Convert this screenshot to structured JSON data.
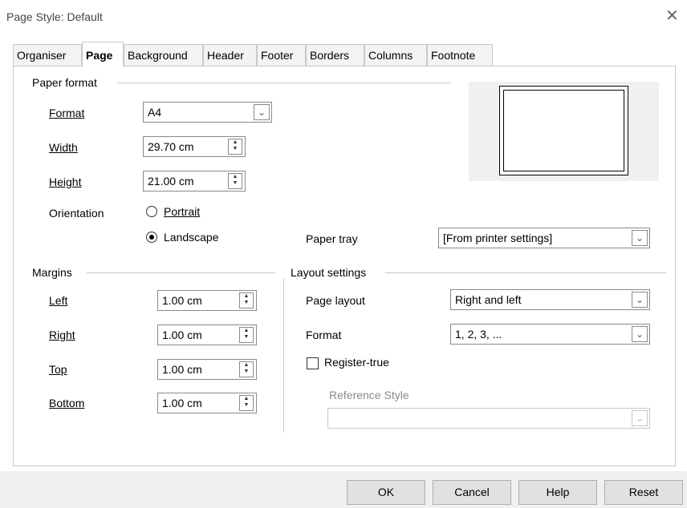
{
  "window": {
    "title": "Page Style: Default",
    "close_glyph": "✕"
  },
  "tabs": [
    "Organiser",
    "Page",
    "Background",
    "Header",
    "Footer",
    "Borders",
    "Columns",
    "Footnote"
  ],
  "active_tab": "Page",
  "paper_format": {
    "section": "Paper format",
    "format_label": "Format",
    "format_value": "A4",
    "width_label": "Width",
    "width_value": "29.70 cm",
    "height_label": "Height",
    "height_value": "21.00 cm",
    "orientation_label": "Orientation",
    "portrait_label": "Portrait",
    "landscape_label": "Landscape",
    "orientation_selected": "Landscape",
    "paper_tray_label": "Paper tray",
    "paper_tray_value": "[From printer settings]"
  },
  "margins": {
    "section": "Margins",
    "left_label": "Left",
    "left_value": "1.00 cm",
    "right_label": "Right",
    "right_value": "1.00 cm",
    "top_label": "Top",
    "top_value": "1.00 cm",
    "bottom_label": "Bottom",
    "bottom_value": "1.00 cm"
  },
  "layout": {
    "section": "Layout settings",
    "page_layout_label": "Page layout",
    "page_layout_value": "Right and left",
    "format_label": "Format",
    "format_value": "1, 2, 3, ...",
    "register_true_label": "Register-true",
    "register_true_checked": false,
    "reference_style_label": "Reference Style",
    "reference_style_value": ""
  },
  "buttons": {
    "ok": "OK",
    "cancel": "Cancel",
    "help": "Help",
    "reset": "Reset"
  },
  "icons": {
    "dropdown": "chevron-down-icon",
    "spin": "spin-updown-icon"
  },
  "colors": {
    "border": "#c9c9c9",
    "footer_bg": "#f0f0f0",
    "button_bg": "#e1e1e1"
  }
}
